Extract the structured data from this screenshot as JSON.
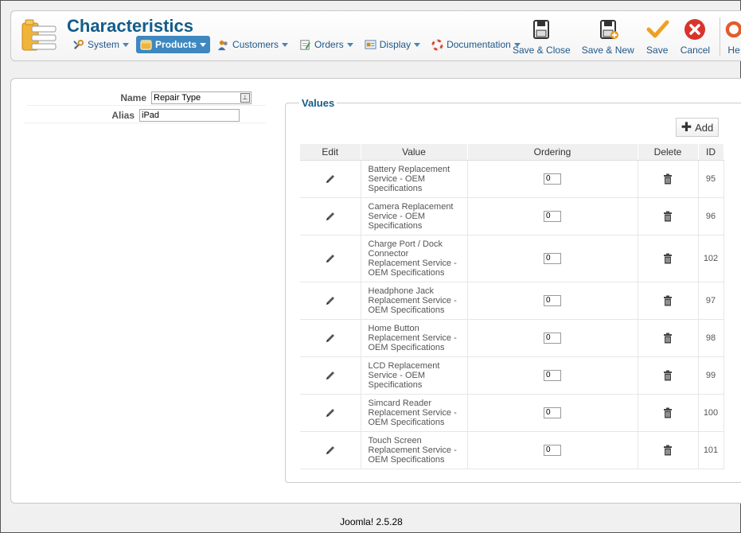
{
  "header": {
    "title": "Characteristics",
    "menu": [
      {
        "label": "System",
        "icon": "wrench-icon"
      },
      {
        "label": "Products",
        "icon": "products-icon",
        "active": true
      },
      {
        "label": "Customers",
        "icon": "customers-icon"
      },
      {
        "label": "Orders",
        "icon": "orders-icon"
      },
      {
        "label": "Display",
        "icon": "display-icon"
      },
      {
        "label": "Documentation",
        "icon": "lifebuoy-icon"
      }
    ],
    "toolbar": {
      "save_close": "Save & Close",
      "save_new": "Save & New",
      "save": "Save",
      "cancel": "Cancel",
      "help": "He"
    }
  },
  "form": {
    "name_label": "Name",
    "name_value": "Repair Type",
    "alias_label": "Alias",
    "alias_value": "iPad"
  },
  "values": {
    "legend": "Values",
    "add_label": "Add",
    "columns": [
      "Edit",
      "Value",
      "Ordering",
      "Delete",
      "ID"
    ],
    "rows": [
      {
        "value": "Battery Replacement Service - OEM Specifications",
        "ordering": "0",
        "id": "95"
      },
      {
        "value": "Camera Replacement Service - OEM Specifications",
        "ordering": "0",
        "id": "96"
      },
      {
        "value": "Charge Port / Dock Connector Replacement Service - OEM Specifications",
        "ordering": "0",
        "id": "102"
      },
      {
        "value": "Headphone Jack Replacement Service - OEM Specifications",
        "ordering": "0",
        "id": "97"
      },
      {
        "value": "Home Button Replacement Service - OEM Specifications",
        "ordering": "0",
        "id": "98"
      },
      {
        "value": "LCD Replacement Service - OEM Specifications",
        "ordering": "0",
        "id": "99"
      },
      {
        "value": "Simcard Reader Replacement Service - OEM Specifications",
        "ordering": "0",
        "id": "100"
      },
      {
        "value": "Touch Screen Replacement Service - OEM Specifications",
        "ordering": "0",
        "id": "101"
      }
    ]
  },
  "footer": {
    "text": "Joomla! 2.5.28"
  },
  "colors": {
    "title": "#135c8a",
    "active_menu": "#3d88c0",
    "link": "#1f5788"
  }
}
